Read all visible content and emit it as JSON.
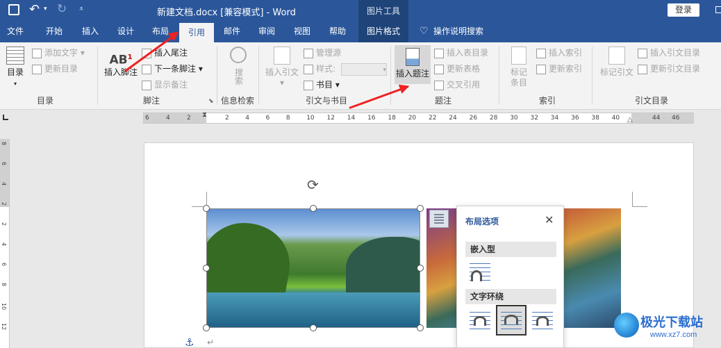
{
  "title": {
    "document": "新建文档.docx [兼容模式]  -  Word",
    "context_group": "图片工具",
    "login": "登录"
  },
  "tabs": [
    "文件",
    "开始",
    "插入",
    "设计",
    "布局",
    "引用",
    "邮件",
    "审阅",
    "视图",
    "帮助",
    "图片格式",
    "操作说明搜索"
  ],
  "active_tab": "引用",
  "ribbon": {
    "toc": {
      "big": "目录",
      "add_text": "添加文字",
      "update": "更新目录",
      "group": "目录"
    },
    "footnotes": {
      "insert_footnote": "插入脚注",
      "insert_endnote": "插入尾注",
      "next_footnote": "下一条脚注",
      "show_notes": "显示备注",
      "group": "脚注"
    },
    "research": {
      "search": "搜索",
      "group": "信息检索"
    },
    "citations": {
      "insert_citation": "插入引文",
      "manage_sources": "管理源",
      "style": "样式:",
      "bibliography": "书目",
      "group": "引文与书目"
    },
    "captions": {
      "insert_caption": "插入题注",
      "insert_table_of_figures": "插入表目录",
      "update_table": "更新表格",
      "cross_reference": "交叉引用",
      "group": "题注"
    },
    "index": {
      "mark_entry": "标记条目",
      "insert_index": "插入索引",
      "update_index": "更新索引",
      "group": "索引"
    },
    "authorities": {
      "mark_citation": "标记引文",
      "insert_toa": "插入引文目录",
      "update_toa": "更新引文目录",
      "group": "引文目录"
    }
  },
  "ruler": {
    "h_labels": [
      "6",
      "4",
      "2",
      "2",
      "4",
      "6",
      "8",
      "10",
      "12",
      "14",
      "16",
      "18",
      "20",
      "22",
      "24",
      "26",
      "28",
      "30",
      "32",
      "34",
      "36",
      "38",
      "40",
      "44",
      "46"
    ],
    "v_labels": [
      "8",
      "6",
      "4",
      "2",
      "2",
      "4",
      "6",
      "8",
      "10",
      "12"
    ]
  },
  "layout_panel": {
    "title": "布局选项",
    "section_inline": "嵌入型",
    "section_wrap": "文字环绕"
  },
  "watermark": {
    "name": "极光下载站",
    "url": "www.xz7.com"
  },
  "colors": {
    "accent": "#2b579a",
    "arrow": "#e22222"
  }
}
